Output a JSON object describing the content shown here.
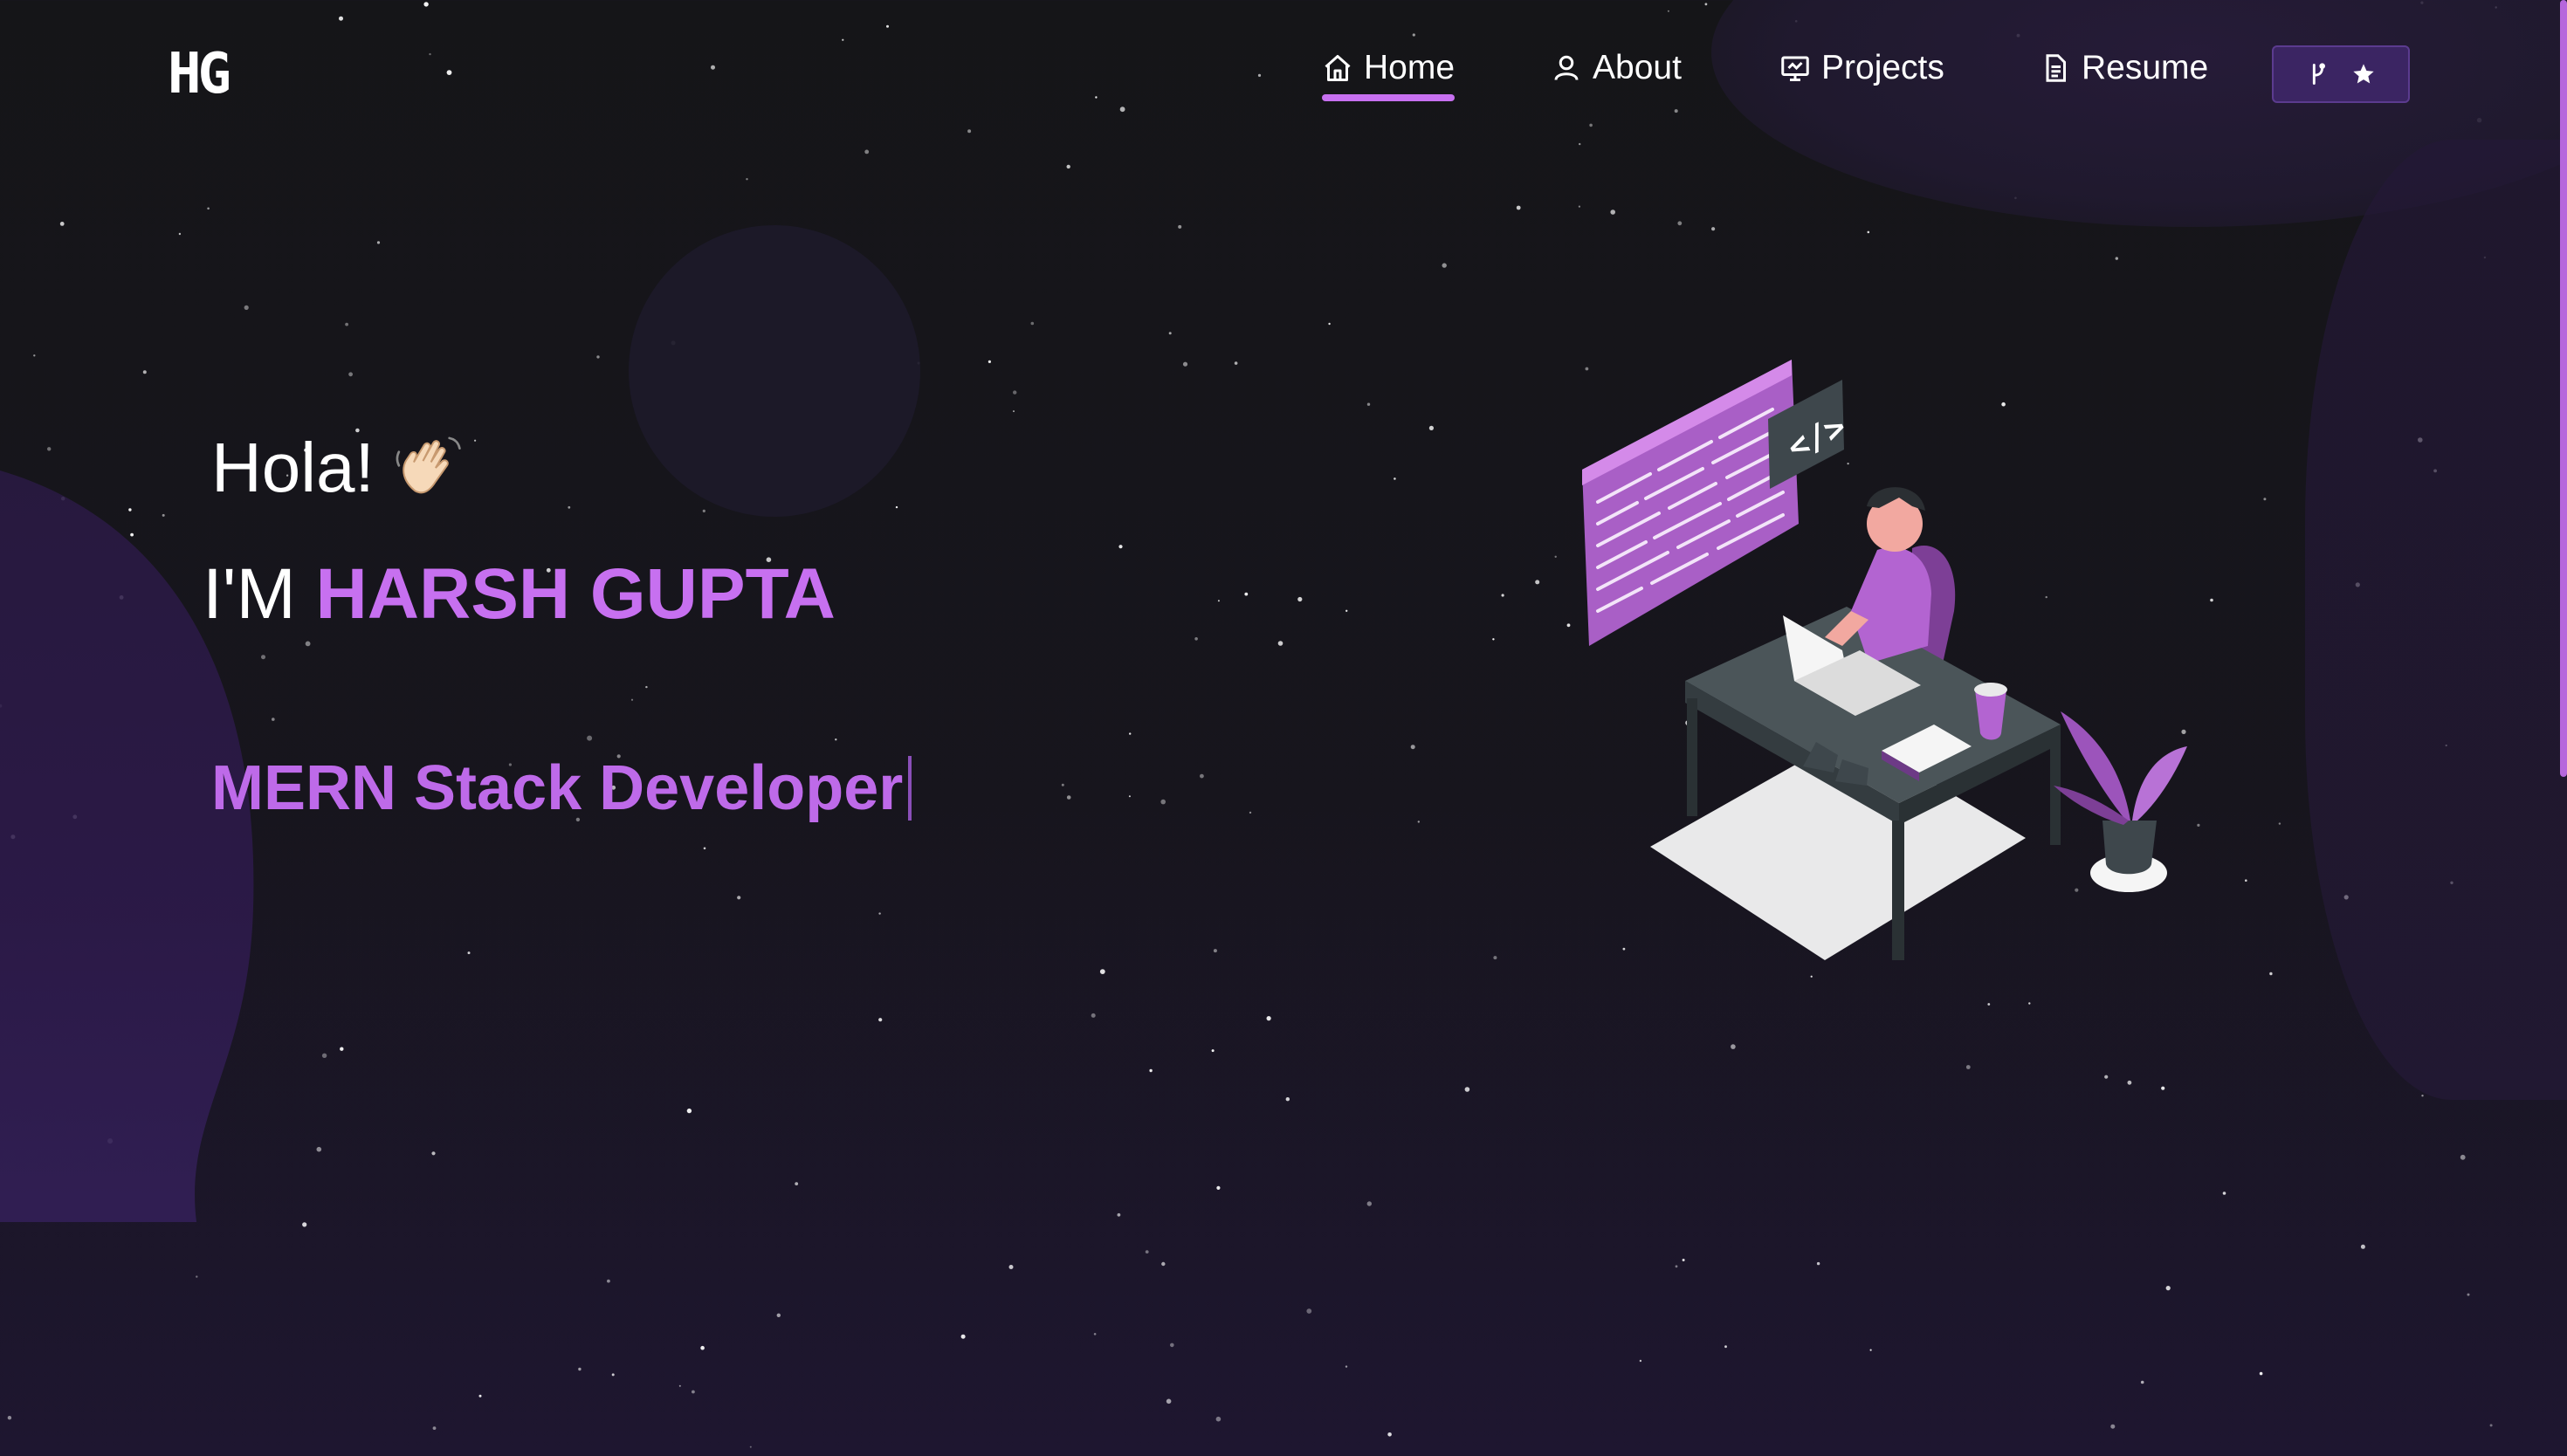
{
  "brand": {
    "logo": "HG"
  },
  "nav": {
    "items": [
      {
        "label": "Home",
        "icon": "home-icon",
        "active": true
      },
      {
        "label": "About",
        "icon": "user-icon"
      },
      {
        "label": "Projects",
        "icon": "projects-icon"
      },
      {
        "label": "Resume",
        "icon": "document-icon"
      }
    ],
    "github_button": {
      "icons": [
        "fork-icon",
        "star-icon"
      ]
    }
  },
  "hero": {
    "greeting": "Hola!",
    "greeting_emoji": "waving-hand-icon",
    "intro_prefix": "I'M",
    "name": "HARSH GUPTA",
    "role": "MERN Stack Developer"
  },
  "colors": {
    "accent": "#c770f0",
    "background": "#151518",
    "button_bg": "#3b2563"
  }
}
